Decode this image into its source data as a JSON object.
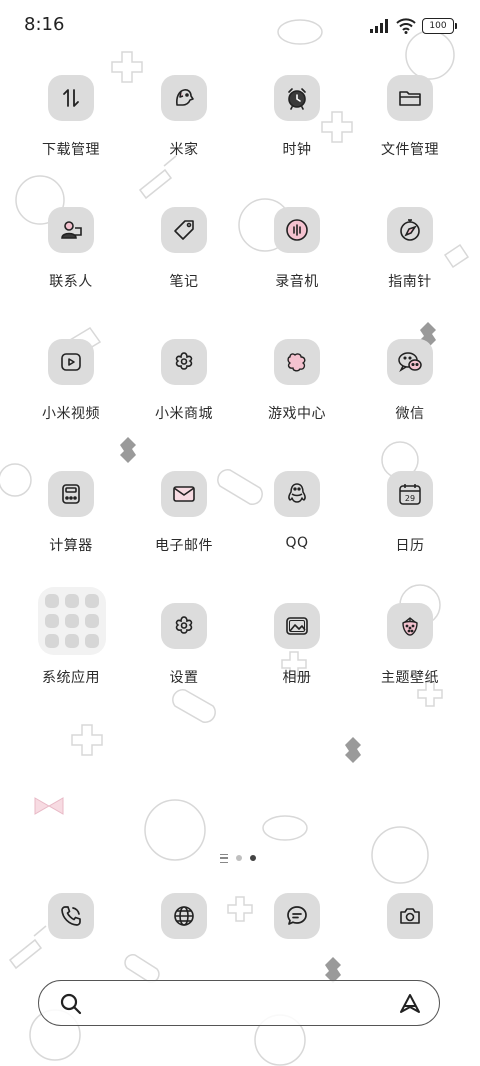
{
  "status_bar": {
    "time": "8:16",
    "battery": "100"
  },
  "rows": [
    [
      {
        "label": "下载管理",
        "icon": "download-arrows-icon"
      },
      {
        "label": "米家",
        "icon": "mijia-dog-icon"
      },
      {
        "label": "时钟",
        "icon": "alarm-clock-icon"
      },
      {
        "label": "文件管理",
        "icon": "folder-icon"
      }
    ],
    [
      {
        "label": "联系人",
        "icon": "contact-person-icon"
      },
      {
        "label": "笔记",
        "icon": "tag-icon"
      },
      {
        "label": "录音机",
        "icon": "recorder-icon"
      },
      {
        "label": "指南针",
        "icon": "compass-icon"
      }
    ],
    [
      {
        "label": "小米视频",
        "icon": "video-play-icon"
      },
      {
        "label": "小米商城",
        "icon": "flower-shop-icon"
      },
      {
        "label": "游戏中心",
        "icon": "game-puzzle-icon"
      },
      {
        "label": "微信",
        "icon": "wechat-icon"
      }
    ],
    [
      {
        "label": "计算器",
        "icon": "calculator-icon"
      },
      {
        "label": "电子邮件",
        "icon": "mail-icon"
      },
      {
        "label": "QQ",
        "icon": "qq-penguin-icon"
      },
      {
        "label": "日历",
        "icon": "calendar-icon",
        "calendar_day": "29"
      }
    ],
    [
      {
        "label": "系统应用",
        "icon": "folder-group-icon"
      },
      {
        "label": "设置",
        "icon": "settings-flower-icon"
      },
      {
        "label": "相册",
        "icon": "photo-gallery-icon"
      },
      {
        "label": "主题壁纸",
        "icon": "strawberry-theme-icon"
      }
    ]
  ],
  "page_indicator": {
    "pages": 3,
    "active": 3
  },
  "dock": [
    {
      "icon": "phone-icon"
    },
    {
      "icon": "browser-globe-icon"
    },
    {
      "icon": "messages-icon"
    },
    {
      "icon": "camera-icon"
    }
  ],
  "search": {
    "left_icon": "search-icon",
    "right_icon": "assistant-icon"
  },
  "colors": {
    "tile": "#dcdcdc",
    "accent_pink": "#f4c2cf",
    "text": "#2b2b2b"
  }
}
